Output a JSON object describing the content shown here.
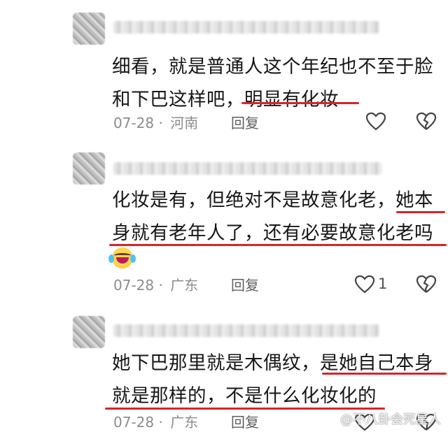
{
  "comments": [
    {
      "line1": "细看，就是普通人这个年纪也不至于脸",
      "line2_plain": "和下巴这样吧，",
      "line2_highlight": "明显有化妆",
      "date": "07-28",
      "region": "河南",
      "reply_label": "回复",
      "like_count": ""
    },
    {
      "line1_plain": "化妆是有，但绝对不是故意化老，",
      "line1_highlight": "她本",
      "line2": "身就有老年人了，还有必要故意化老吗",
      "emoji": "laugh-cry-emoji",
      "date": "07-28",
      "region": "广东",
      "reply_label": "回复",
      "like_count": "1"
    },
    {
      "line1_plain": "她下巴那里就是木偶纹，",
      "line1_highlight": "是她自己本身",
      "line2": "就是那样的，不是什么化妆化的",
      "date": "07-28",
      "region": "广东",
      "reply_label": "回复",
      "like_count": ""
    }
  ],
  "watermark": "@不八卦会死星人",
  "colors": {
    "underline": "#d6262b",
    "meta": "#8c8c8c",
    "text": "#161616"
  },
  "icons": [
    "heart-outline-icon",
    "heart-broken-icon"
  ]
}
